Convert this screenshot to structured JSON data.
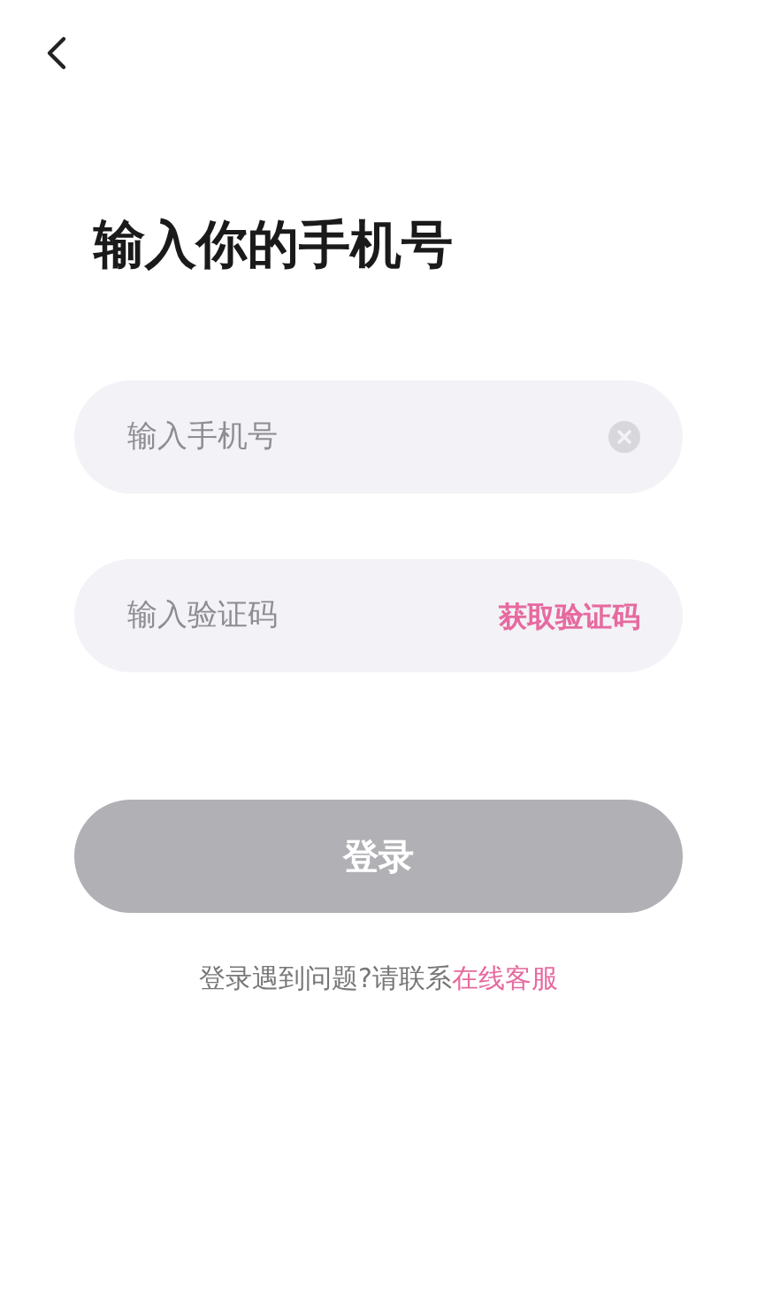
{
  "title": "输入你的手机号",
  "phone_field": {
    "placeholder": "输入手机号",
    "clear_button": true
  },
  "code_field": {
    "placeholder": "输入验证码",
    "action": "获取验证码"
  },
  "login_button": {
    "label": "登录",
    "disabled": true
  },
  "help": {
    "text": "登录遇到问题?请联系",
    "link": "在线客服"
  }
}
